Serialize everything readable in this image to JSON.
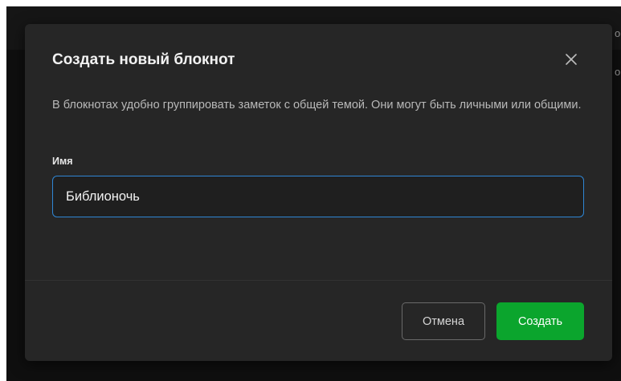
{
  "background": {
    "edge_glyph_1": "о",
    "edge_glyph_2": "о"
  },
  "dialog": {
    "title": "Создать новый блокнот",
    "close_icon": "close-icon",
    "description": "В блокнотах удобно группировать заметок с общей темой. Они могут быть личными или общими.",
    "name_label": "Имя",
    "name_value": "Библионочь",
    "cancel_label": "Отмена",
    "create_label": "Создать"
  },
  "colors": {
    "dialog_bg": "#262626",
    "input_focus_border": "#2f86d4",
    "primary_button": "#0ba52d"
  }
}
